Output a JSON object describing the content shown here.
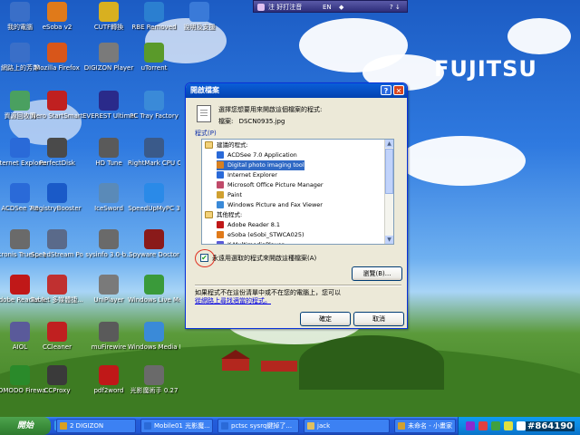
{
  "desktop": {
    "brand": "FUJITSU",
    "icons": [
      {
        "label": "我的電腦",
        "icon": "computer-icon",
        "color": "#3a6fc8"
      },
      {
        "label": "eSoba v2",
        "icon": "app-icon",
        "color": "#e07a1a"
      },
      {
        "label": "CUTF轉換",
        "icon": "app-icon",
        "color": "#d8b020"
      },
      {
        "label": "RBE Removed",
        "icon": "app-icon",
        "color": "#2b7fd0"
      },
      {
        "label": "說明及支援",
        "icon": "help-icon",
        "color": "#3a7ad8"
      },
      {
        "label": "網路上的芳鄰",
        "icon": "network-icon",
        "color": "#3a6fc8"
      },
      {
        "label": "Mozilla Firefox",
        "icon": "firefox-icon",
        "color": "#d8561a"
      },
      {
        "label": "DIGIZON Player",
        "icon": "player-icon",
        "color": "#7a7a7a"
      },
      {
        "label": "uTorrent",
        "icon": "torrent-icon",
        "color": "#5a9a2a"
      },
      {
        "label": "資源回收筒",
        "icon": "recycle-bin-icon",
        "color": "#4aa060"
      },
      {
        "label": "Nero StartSmart",
        "icon": "nero-icon",
        "color": "#c02020"
      },
      {
        "label": "EVEREST Ultimate",
        "icon": "everest-icon",
        "color": "#2a2a8a"
      },
      {
        "label": "PC Tray Factory",
        "icon": "app-icon",
        "color": "#3a8ad8"
      },
      {
        "label": "Internet Explorer",
        "icon": "ie-icon",
        "color": "#2a6ad8"
      },
      {
        "label": "PerfectDisk",
        "icon": "disk-icon",
        "color": "#4a4a4a"
      },
      {
        "label": "HD Tune",
        "icon": "disk-icon",
        "color": "#5a5a5a"
      },
      {
        "label": "RightMark CPU Clock",
        "icon": "cpu-icon",
        "color": "#3a5a8a"
      },
      {
        "label": "ACDSee 7.0",
        "icon": "acdsee-icon",
        "color": "#2a6ad8"
      },
      {
        "label": "RegistryBooster 2",
        "icon": "registry-icon",
        "color": "#1a5ac8"
      },
      {
        "label": "IceSword",
        "icon": "sword-icon",
        "color": "#5a8ab8"
      },
      {
        "label": "SpeedUpMyPC 3",
        "icon": "speed-icon",
        "color": "#2a8ae8"
      },
      {
        "label": "Acronis TrueI... 10.0",
        "icon": "acronis-icon",
        "color": "#6a6a6a"
      },
      {
        "label": "SpeedStream PowerLine C...",
        "icon": "network-icon",
        "color": "#5a6a8a"
      },
      {
        "label": "sysinfo 3.0-b...",
        "icon": "info-icon",
        "color": "#6a6a6a"
      },
      {
        "label": "Spyware Doctor",
        "icon": "doctor-icon",
        "color": "#8a1a1a"
      },
      {
        "label": "Adobe Reader 8",
        "icon": "pdf-icon",
        "color": "#c01818"
      },
      {
        "label": "Tablet 多媒體捷...",
        "icon": "tablet-icon",
        "color": "#c03030"
      },
      {
        "label": "UniPlayer",
        "icon": "player-icon",
        "color": "#7a7a7a"
      },
      {
        "label": "Windows Live Messenger",
        "icon": "messenger-icon",
        "color": "#3a9a3a"
      },
      {
        "label": "AIOL",
        "icon": "app-icon",
        "color": "#5a5a9a"
      },
      {
        "label": "CCleaner",
        "icon": "ccleaner-icon",
        "color": "#c02020"
      },
      {
        "label": "muFirewire",
        "icon": "app-icon",
        "color": "#5a5a5a"
      },
      {
        "label": "Windows Media Player",
        "icon": "media-player-icon",
        "color": "#3a8ad8"
      },
      {
        "label": "COMODO Firewall Pro",
        "icon": "firewall-icon",
        "color": "#2a8a2a"
      },
      {
        "label": "CCProxy",
        "icon": "proxy-icon",
        "color": "#3a3a3a"
      },
      {
        "label": "pdf2word",
        "icon": "pdf-icon",
        "color": "#c01818"
      },
      {
        "label": "光影魔術手 0.27",
        "icon": "camera-icon",
        "color": "#6a6a6a"
      }
    ]
  },
  "langbar": {
    "ime": "注 好打注音",
    "lang": "EN",
    "arrow": "◆",
    "icons": "? ↓"
  },
  "dialog": {
    "title": "開啟檔案",
    "help": "?",
    "close": "✕",
    "instruction": "選擇您想要用來開啟這個檔案的程式:",
    "file_label": "檔案:",
    "file_name": "DSCN0935.jpg",
    "programs_label": "程式(P)",
    "recommended_header": "建議的程式:",
    "recommended": [
      {
        "name": "ACDSee 7.0 Application",
        "color": "#2a6ad8"
      },
      {
        "name": "Digital photo imaging tool",
        "color": "#d88020",
        "selected": true
      },
      {
        "name": "Internet Explorer",
        "color": "#2a6ad8"
      },
      {
        "name": "Microsoft Office Picture Manager",
        "color": "#c04a6a"
      },
      {
        "name": "Paint",
        "color": "#d0a030"
      },
      {
        "name": "Windows Picture and Fax Viewer",
        "color": "#3a8ad8"
      }
    ],
    "other_header": "其他程式:",
    "other": [
      {
        "name": "Adobe Reader 8.1",
        "color": "#c01818"
      },
      {
        "name": "eSoba (eSobi_STWCA025)",
        "color": "#e07a1a"
      },
      {
        "name": "K-MultimediaPlayer",
        "color": "#5a5ad8"
      }
    ],
    "always_use": "永遠用選取的程式來開啟這種檔案(A)",
    "always_checked": "✔",
    "browse": "瀏覽(B)...",
    "note_line1": "如果程式不在這份清單中或不在您的電腦上，您可以",
    "note_link": "從網路上尋找適當的程式。",
    "ok": "確定",
    "cancel": "取消"
  },
  "taskbar": {
    "start": "開始",
    "items": [
      {
        "label": "2 DIGIZON",
        "color": "#d8a020"
      },
      {
        "label": "Mobile01 光影魔...",
        "color": "#2a6ad8"
      },
      {
        "label": "pctsc sysrq鍵掉了...",
        "color": "#2a6ad8"
      },
      {
        "label": "jack",
        "color": "#e0c060"
      },
      {
        "label": "未命名 - 小畫家",
        "color": "#d0a030"
      }
    ],
    "watermark": "#864190"
  }
}
